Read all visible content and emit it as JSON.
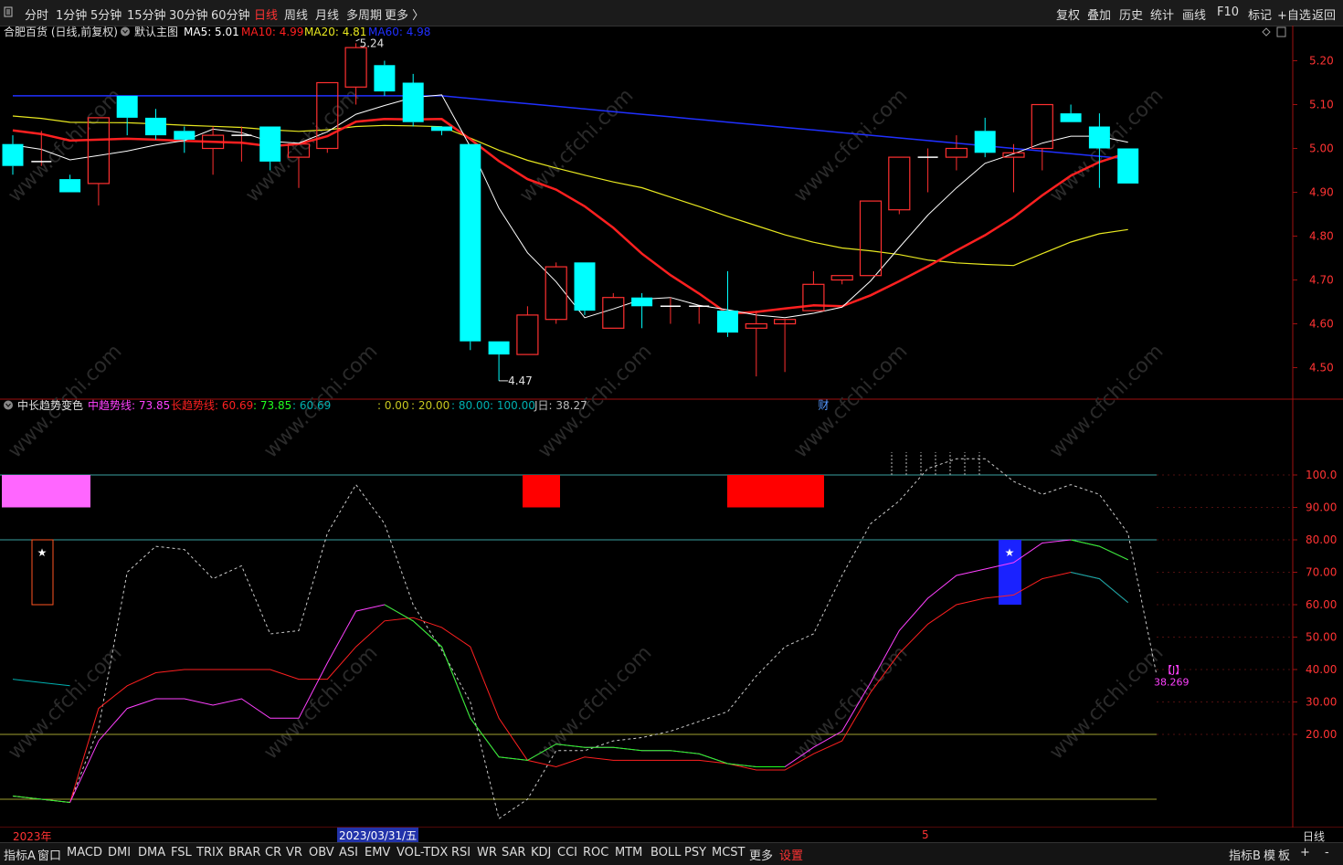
{
  "periods": [
    "分时",
    "1分钟",
    "5分钟",
    "15分钟",
    "30分钟",
    "60分钟",
    "日线",
    "周线",
    "月线",
    "多周期",
    "更多 〉"
  ],
  "active_period": "日线",
  "right_tools": [
    "复权",
    "叠加",
    "历史",
    "统计",
    "画线",
    "F10",
    "标记",
    "+自选",
    "返回"
  ],
  "main": {
    "stock_title": "合肥百货 (日线,前复权)",
    "indicator_name": "默认主图",
    "ma": [
      {
        "label": "MA5: 5.01",
        "color": "#ffffff"
      },
      {
        "label": "MA10: 4.99",
        "color": "#ff2020"
      },
      {
        "label": "MA20: 4.81",
        "color": "#e8e820"
      },
      {
        "label": "MA60: 4.98",
        "color": "#2030ff"
      }
    ],
    "price_ticks": [
      "5.20",
      "5.10",
      "5.00",
      "4.90",
      "4.80",
      "4.70",
      "4.60",
      "4.50"
    ],
    "high_label": "5.24",
    "low_label": "4.47",
    "marker_cai": "财",
    "watermark": "www.cfchi.com"
  },
  "sub": {
    "indicator_name": "中长趋势变色",
    "lines": [
      {
        "label": "中趋势线: 73.85",
        "color": "#ff40ff"
      },
      {
        "label": "长趋势线: 60.69",
        "color": "#ff2020"
      },
      {
        "label": ": 73.85",
        "color": "#20ff20"
      },
      {
        "label": ": 60.69",
        "color": "#00b0b0"
      }
    ],
    "extra": [
      {
        "label": ": 0.00",
        "color": "#c8c820"
      },
      {
        "label": ": 20.00",
        "color": "#c8c820"
      },
      {
        "label": ": 80.00",
        "color": "#00b0b0"
      },
      {
        "label": ": 100.00",
        "color": "#00b0b0"
      },
      {
        "label": "J日: 38.27",
        "color": "#bbbbbb"
      }
    ],
    "ticks": [
      "100.0",
      "90.00",
      "80.00",
      "70.00",
      "60.00",
      "50.00",
      "40.00",
      "30.00",
      "20.00"
    ],
    "j_value": "38.269",
    "j_marker": "【J】",
    "star": "★"
  },
  "dates": {
    "start": "2023年",
    "selected": "2023/03/31/五",
    "month": "5",
    "period_label": "日线"
  },
  "bottom_tabs": [
    "指标A",
    "窗口",
    "MACD",
    "DMI",
    "DMA",
    "FSL",
    "TRIX",
    "BRAR",
    "CR",
    "VR",
    "OBV",
    "ASI",
    "EMV",
    "VOL-TDX",
    "RSI",
    "WR",
    "SAR",
    "KDJ",
    "CCI",
    "ROC",
    "MTM",
    "BOLL",
    "PSY",
    "MCST",
    "更多",
    "设置"
  ],
  "bottom_right": [
    "指标B",
    "模",
    "板",
    "+",
    "-"
  ],
  "candles": [
    [
      5.01,
      5.03,
      4.94,
      4.96
    ],
    [
      4.97,
      5.04,
      4.96,
      4.97
    ],
    [
      4.93,
      4.94,
      4.9,
      4.9
    ],
    [
      4.92,
      5.07,
      4.87,
      5.07
    ],
    [
      5.12,
      5.12,
      5.03,
      5.07
    ],
    [
      5.07,
      5.09,
      5.02,
      5.03
    ],
    [
      5.04,
      5.05,
      4.99,
      5.02
    ],
    [
      5.0,
      5.05,
      4.94,
      5.03
    ],
    [
      5.03,
      5.05,
      4.97,
      5.03
    ],
    [
      5.05,
      5.05,
      4.95,
      4.97
    ],
    [
      4.98,
      5.01,
      4.91,
      5.01
    ],
    [
      5.0,
      5.15,
      4.99,
      5.15
    ],
    [
      5.14,
      5.24,
      5.1,
      5.23
    ],
    [
      5.19,
      5.2,
      5.12,
      5.13
    ],
    [
      5.15,
      5.17,
      5.05,
      5.06
    ],
    [
      5.05,
      5.05,
      5.03,
      5.04
    ],
    [
      5.01,
      5.01,
      4.54,
      4.56
    ],
    [
      4.56,
      4.56,
      4.47,
      4.53
    ],
    [
      4.53,
      4.64,
      4.53,
      4.62
    ],
    [
      4.61,
      4.74,
      4.6,
      4.73
    ],
    [
      4.74,
      4.74,
      4.62,
      4.63
    ],
    [
      4.59,
      4.67,
      4.59,
      4.66
    ],
    [
      4.66,
      4.67,
      4.59,
      4.64
    ],
    [
      4.64,
      4.66,
      4.6,
      4.64
    ],
    [
      4.64,
      4.64,
      4.6,
      4.64
    ],
    [
      4.63,
      4.72,
      4.57,
      4.58
    ],
    [
      4.59,
      4.63,
      4.48,
      4.6
    ],
    [
      4.6,
      4.6,
      4.49,
      4.61
    ],
    [
      4.63,
      4.72,
      4.63,
      4.69
    ],
    [
      4.7,
      4.71,
      4.69,
      4.71
    ],
    [
      4.71,
      4.88,
      4.71,
      4.88
    ],
    [
      4.86,
      4.98,
      4.85,
      4.98
    ],
    [
      4.98,
      5.0,
      4.9,
      4.98
    ],
    [
      4.98,
      5.03,
      4.95,
      5.0
    ],
    [
      5.04,
      5.07,
      4.98,
      4.99
    ],
    [
      4.98,
      5.01,
      4.9,
      4.99
    ],
    [
      5.0,
      5.1,
      4.95,
      5.1
    ],
    [
      5.08,
      5.1,
      5.06,
      5.06
    ],
    [
      5.05,
      5.08,
      4.91,
      5.0
    ],
    [
      5.0,
      5.0,
      4.92,
      4.92
    ]
  ]
}
